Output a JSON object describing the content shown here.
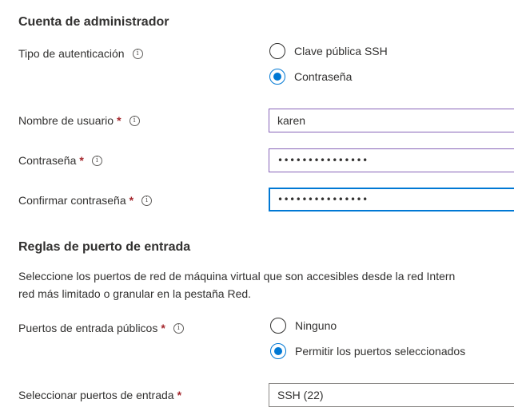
{
  "admin_section": {
    "title": "Cuenta de administrador",
    "auth_type": {
      "label": "Tipo de autenticación",
      "options": [
        {
          "label": "Clave pública SSH",
          "selected": false
        },
        {
          "label": "Contraseña",
          "selected": true
        }
      ]
    },
    "username": {
      "label": "Nombre de usuario",
      "required": "*",
      "value": "karen"
    },
    "password": {
      "label": "Contraseña",
      "required": "*",
      "value": "•••••••••••••••"
    },
    "confirm_password": {
      "label": "Confirmar contraseña",
      "required": "*",
      "value": "•••••••••••••••"
    }
  },
  "inbound_section": {
    "title": "Reglas de puerto de entrada",
    "description_line1": "Seleccione los puertos de red de máquina virtual que son accesibles desde la red Intern",
    "description_line2": "red más limitado o granular en la pestaña Red.",
    "public_ports": {
      "label": "Puertos de entrada públicos",
      "required": "*",
      "options": [
        {
          "label": "Ninguno",
          "selected": false
        },
        {
          "label": "Permitir los puertos seleccionados",
          "selected": true
        }
      ]
    },
    "select_ports": {
      "label": "Seleccionar puertos de entrada",
      "required": "*",
      "value": "SSH (22)"
    }
  },
  "icons": {
    "info": "info-icon",
    "info_glyph": "i"
  },
  "colors": {
    "accent": "#0078d4",
    "required": "#a4262c",
    "input_border_active": "#8764b8"
  }
}
